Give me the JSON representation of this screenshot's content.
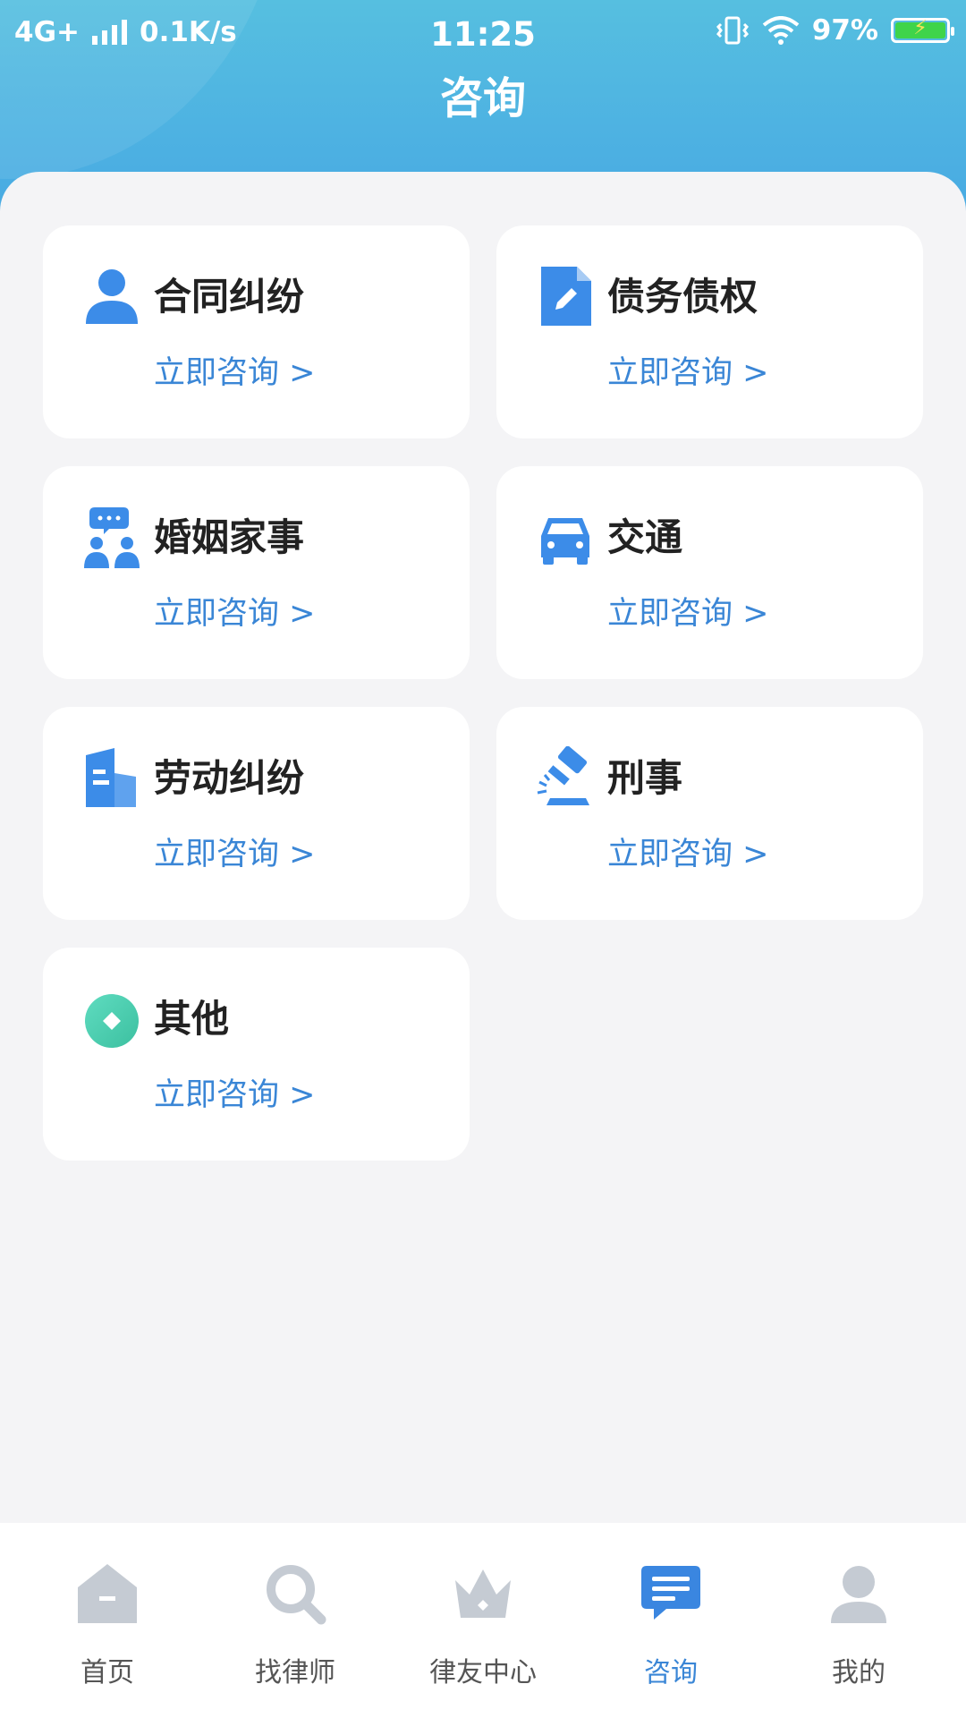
{
  "status_bar": {
    "network": "4G+",
    "speed": "0.1K/s",
    "time": "11:25",
    "battery": "97%"
  },
  "header": {
    "title": "咨询"
  },
  "categories": [
    {
      "name": "合同纠纷",
      "cta": "立即咨询 >",
      "icon": "person-icon"
    },
    {
      "name": "债务债权",
      "cta": "立即咨询 >",
      "icon": "document-edit-icon"
    },
    {
      "name": "婚姻家事",
      "cta": "立即咨询 >",
      "icon": "couple-chat-icon"
    },
    {
      "name": "交通",
      "cta": "立即咨询 >",
      "icon": "car-icon"
    },
    {
      "name": "劳动纠纷",
      "cta": "立即咨询 >",
      "icon": "building-icon"
    },
    {
      "name": "刑事",
      "cta": "立即咨询 >",
      "icon": "gavel-icon"
    },
    {
      "name": "其他",
      "cta": "立即咨询 >",
      "icon": "other-icon"
    }
  ],
  "tabbar": {
    "items": [
      {
        "label": "首页",
        "icon": "home-icon"
      },
      {
        "label": "找律师",
        "icon": "search-icon"
      },
      {
        "label": "律友中心",
        "icon": "crown-icon"
      },
      {
        "label": "咨询",
        "icon": "chat-icon",
        "active": true
      },
      {
        "label": "我的",
        "icon": "user-icon"
      }
    ]
  },
  "colors": {
    "accent": "#3a86d6",
    "icon_blue": "#3c8ce8",
    "other_green": "#3ccaa8",
    "tab_inactive": "#c5cbd3"
  }
}
